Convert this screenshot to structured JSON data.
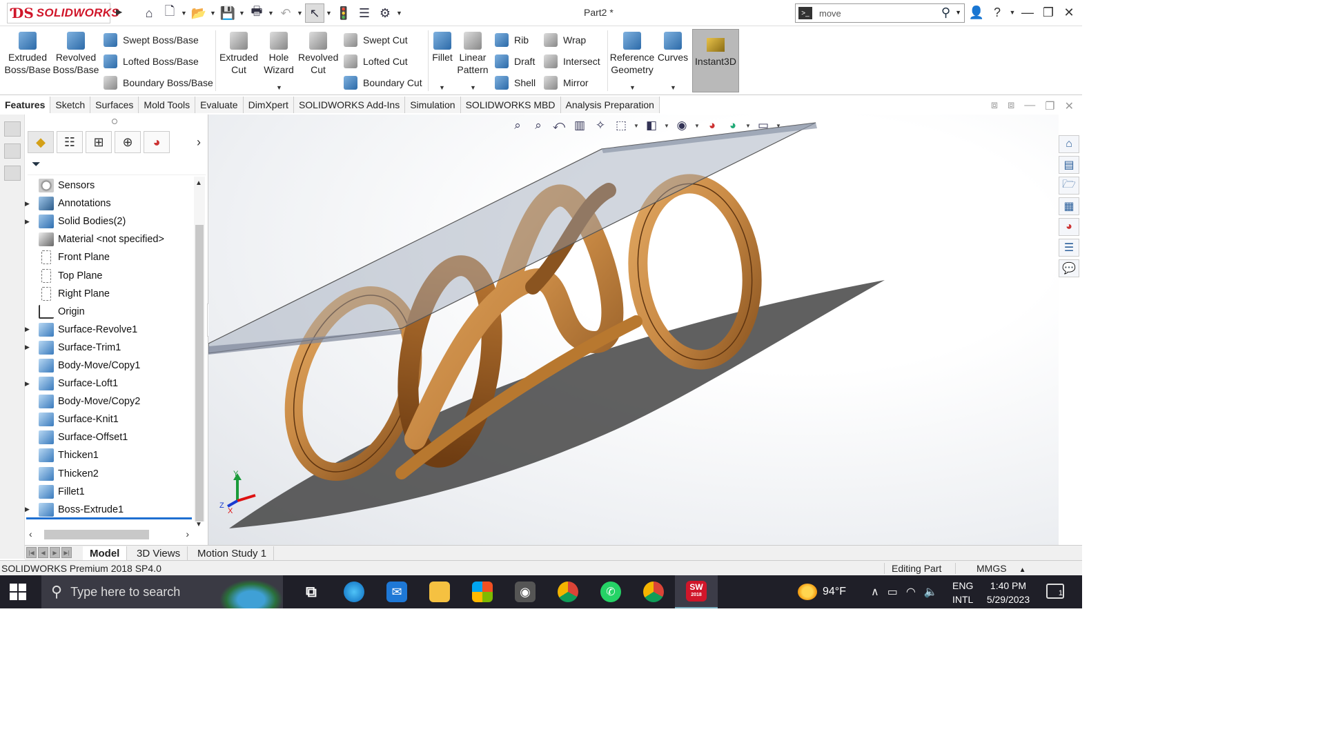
{
  "app": {
    "logo_text": "SOLIDWORKS",
    "doc_title": "Part2 *",
    "search_value": "move"
  },
  "ribbon": {
    "extruded_boss": "Extruded Boss/Base",
    "revolved_boss": "Revolved Boss/Base",
    "swept_boss": "Swept Boss/Base",
    "lofted_boss": "Lofted Boss/Base",
    "boundary_boss": "Boundary Boss/Base",
    "extruded_cut": "Extruded Cut",
    "hole_wizard": "Hole Wizard",
    "revolved_cut": "Revolved Cut",
    "swept_cut": "Swept Cut",
    "lofted_cut": "Lofted Cut",
    "boundary_cut": "Boundary Cut",
    "fillet": "Fillet",
    "linear_pattern": "Linear Pattern",
    "rib": "Rib",
    "draft": "Draft",
    "shell": "Shell",
    "wrap": "Wrap",
    "intersect": "Intersect",
    "mirror": "Mirror",
    "reference_geometry": "Reference Geometry",
    "curves": "Curves",
    "instant3d": "Instant3D"
  },
  "command_tabs": [
    "Features",
    "Sketch",
    "Surfaces",
    "Mold Tools",
    "Evaluate",
    "DimXpert",
    "SOLIDWORKS Add-Ins",
    "Simulation",
    "SOLIDWORKS MBD",
    "Analysis Preparation"
  ],
  "tree": [
    {
      "label": "Sensors",
      "icon": "sensor-icon",
      "expandable": false
    },
    {
      "label": "Annotations",
      "icon": "annotations-icon",
      "expandable": true
    },
    {
      "label": "Solid Bodies(2)",
      "icon": "solid-bodies-icon",
      "expandable": true
    },
    {
      "label": "Material <not specified>",
      "icon": "material-icon",
      "expandable": false
    },
    {
      "label": "Front Plane",
      "icon": "plane-icon",
      "expandable": false
    },
    {
      "label": "Top Plane",
      "icon": "plane-icon",
      "expandable": false
    },
    {
      "label": "Right Plane",
      "icon": "plane-icon",
      "expandable": false
    },
    {
      "label": "Origin",
      "icon": "origin-icon",
      "expandable": false
    },
    {
      "label": "Surface-Revolve1",
      "icon": "surface-revolve-icon",
      "expandable": true
    },
    {
      "label": "Surface-Trim1",
      "icon": "surface-trim-icon",
      "expandable": true
    },
    {
      "label": "Body-Move/Copy1",
      "icon": "body-move-icon",
      "expandable": false
    },
    {
      "label": "Surface-Loft1",
      "icon": "surface-loft-icon",
      "expandable": true
    },
    {
      "label": "Body-Move/Copy2",
      "icon": "body-move-icon",
      "expandable": false
    },
    {
      "label": "Surface-Knit1",
      "icon": "surface-knit-icon",
      "expandable": false
    },
    {
      "label": "Surface-Offset1",
      "icon": "surface-offset-icon",
      "expandable": false
    },
    {
      "label": "Thicken1",
      "icon": "thicken-icon",
      "expandable": false
    },
    {
      "label": "Thicken2",
      "icon": "thicken-icon",
      "expandable": false
    },
    {
      "label": "Fillet1",
      "icon": "fillet-icon",
      "expandable": false
    },
    {
      "label": "Boss-Extrude1",
      "icon": "boss-extrude-icon",
      "expandable": true
    }
  ],
  "model_tabs": [
    "Model",
    "3D Views",
    "Motion Study 1"
  ],
  "status": {
    "product": "SOLIDWORKS Premium 2018 SP4.0",
    "mode": "Editing Part",
    "units": "MMGS"
  },
  "taskbar": {
    "search_placeholder": "Type here to search",
    "temperature": "94°F",
    "lang_line1": "ENG",
    "lang_line2": "INTL",
    "time": "1:40 PM",
    "date": "5/29/2023",
    "notification_count": "1",
    "sw_badge": "SW",
    "sw_year": "2018"
  },
  "triad": {
    "x": "X",
    "y": "Y",
    "z": "Z"
  },
  "colors": {
    "brand_red": "#d0162a",
    "wood_light": "#c98a45",
    "wood_dark": "#7a4616",
    "glass": "#9aa3b5",
    "instant3d_active": "#b9b9b9"
  }
}
